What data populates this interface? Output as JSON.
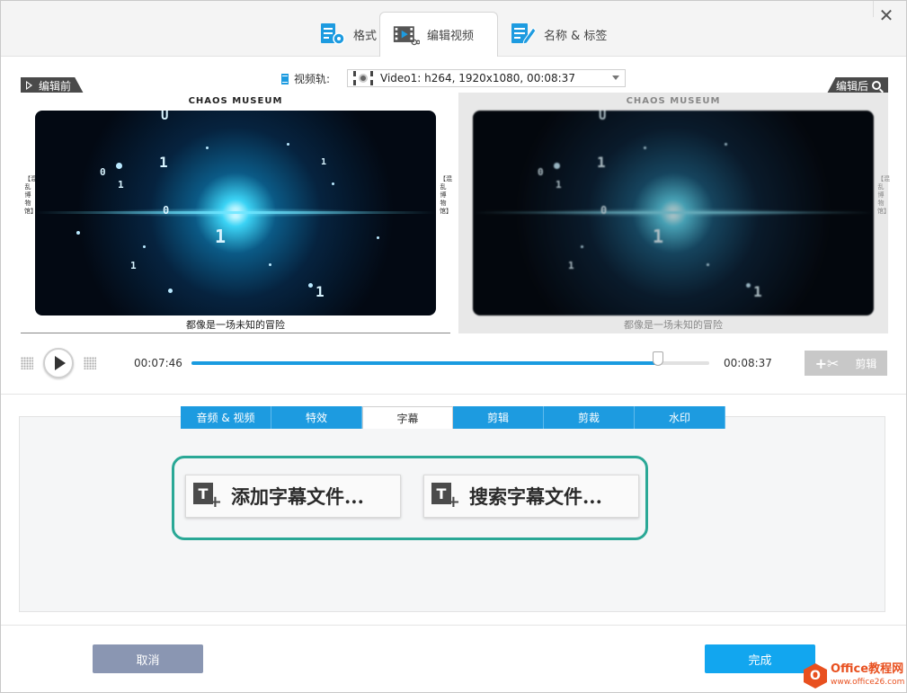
{
  "tabs": [
    {
      "label": "格式",
      "icon": "format-settings-icon"
    },
    {
      "label": "编辑视频",
      "icon": "video-edit-icon"
    },
    {
      "label": "名称 & 标签",
      "icon": "name-tag-edit-icon"
    }
  ],
  "track": {
    "label": "视频轨:",
    "selected": "Video1: h264, 1920x1080, 00:08:37"
  },
  "before_label": "编辑前",
  "after_label": "编辑后",
  "preview": {
    "title": "CHAOS MUSEUM",
    "subtitle": "都像是一场未知的冒险",
    "side_text": "【混乱博物馆】"
  },
  "playback": {
    "current_time": "00:07:46",
    "total_time": "00:08:37",
    "progress_fraction": 0.901,
    "cut_label": "剪辑"
  },
  "subtabs": [
    {
      "label": "音频 & 视频",
      "active": false
    },
    {
      "label": "特效",
      "active": false
    },
    {
      "label": "字幕",
      "active": true
    },
    {
      "label": "剪辑",
      "active": false
    },
    {
      "label": "剪裁",
      "active": false
    },
    {
      "label": "水印",
      "active": false
    }
  ],
  "subtitle_panel": {
    "add_label": "添加字幕文件...",
    "search_label": "搜索字幕文件..."
  },
  "footer": {
    "cancel": "取消",
    "done": "完成"
  },
  "watermark": {
    "main": "Office教程网",
    "sub": "www.office26.com"
  },
  "colors": {
    "accent": "#1d9be0",
    "done": "#12a6ef",
    "cancel": "#8a96b2",
    "highlight": "#2aa896"
  }
}
